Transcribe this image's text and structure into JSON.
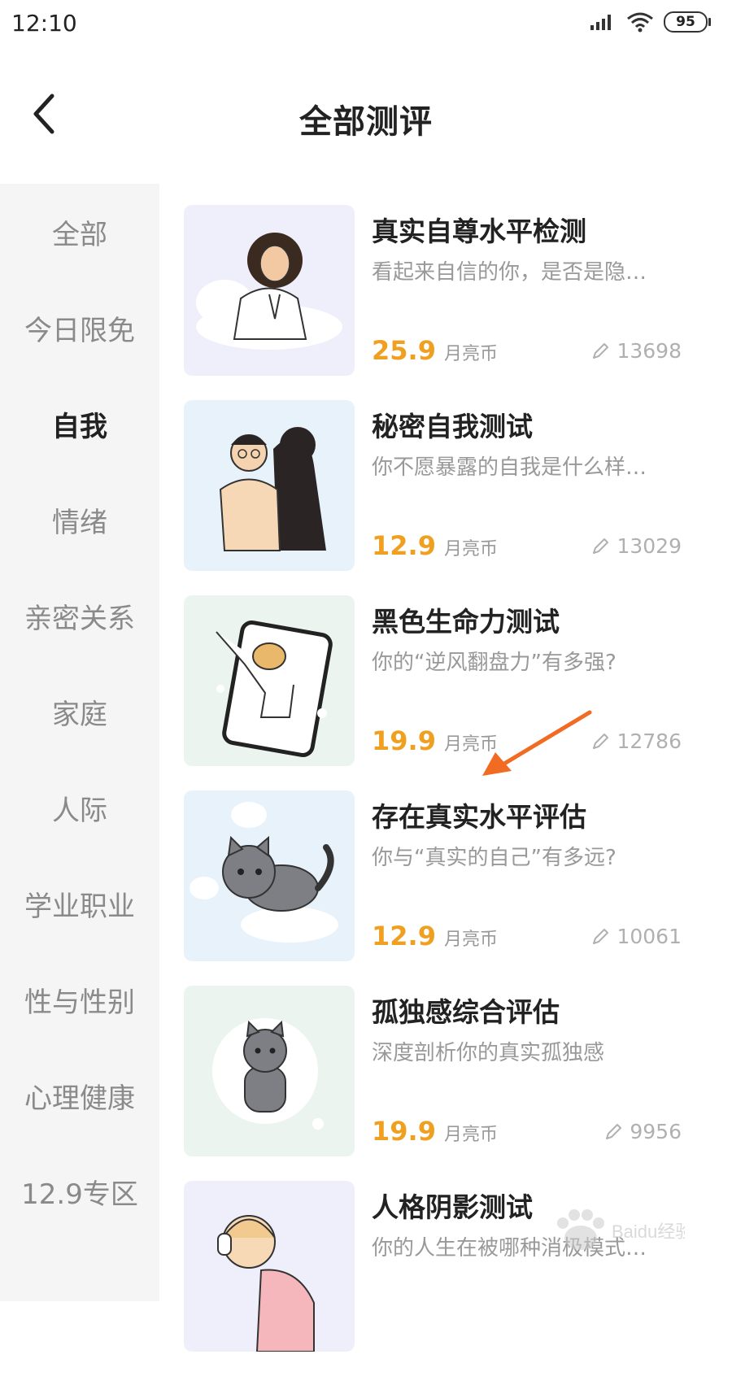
{
  "status_bar": {
    "time": "12:10",
    "battery": "95"
  },
  "header": {
    "title": "全部测评"
  },
  "sidebar": {
    "items": [
      {
        "label": "全部"
      },
      {
        "label": "今日限免"
      },
      {
        "label": "自我",
        "active": true
      },
      {
        "label": "情绪"
      },
      {
        "label": "亲密关系"
      },
      {
        "label": "家庭"
      },
      {
        "label": "人际"
      },
      {
        "label": "学业职业"
      },
      {
        "label": "性与性别"
      },
      {
        "label": "心理健康"
      },
      {
        "label": "12.9专区"
      }
    ]
  },
  "cards": [
    {
      "title": "真实自尊水平检测",
      "desc": "看起来自信的你，是否是隐…",
      "price": "25.9",
      "unit": "月亮币",
      "count": "13698",
      "thumb_bg": "#eeeffa"
    },
    {
      "title": "秘密自我测试",
      "desc": "你不愿暴露的自我是什么样…",
      "price": "12.9",
      "unit": "月亮币",
      "count": "13029",
      "thumb_bg": "#e8f2fb"
    },
    {
      "title": "黑色生命力测试",
      "desc": "你的“逆风翻盘力”有多强?",
      "price": "19.9",
      "unit": "月亮币",
      "count": "12786",
      "thumb_bg": "#ebf4ef"
    },
    {
      "title": "存在真实水平评估",
      "desc": "你与“真实的自己”有多远?",
      "price": "12.9",
      "unit": "月亮币",
      "count": "10061",
      "thumb_bg": "#e8f2fb"
    },
    {
      "title": "孤独感综合评估",
      "desc": "深度剖析你的真实孤独感",
      "price": "19.9",
      "unit": "月亮币",
      "count": "9956",
      "thumb_bg": "#ebf4ef"
    },
    {
      "title": "人格阴影测试",
      "desc": "你的人生在被哪种消极模式…",
      "price": "",
      "unit": "",
      "count": "",
      "thumb_bg": "#eeeffa"
    }
  ],
  "colors": {
    "accent_price": "#f0a020",
    "arrow": "#f26b22"
  },
  "watermark": "Baidu经验"
}
